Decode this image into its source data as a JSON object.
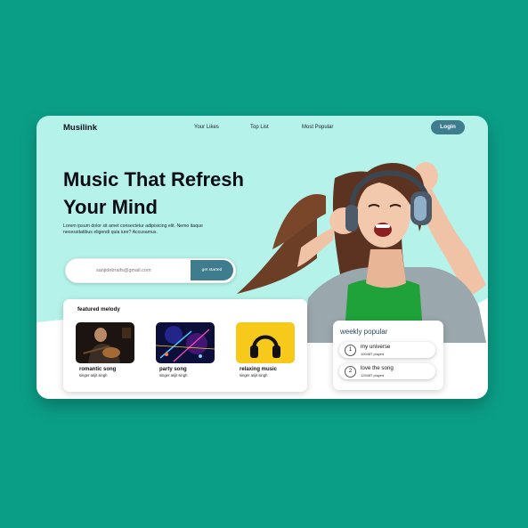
{
  "nav": {
    "logo": "Musilink",
    "links": [
      "Your Likes",
      "Top List",
      "Most Popular"
    ],
    "login": "Login"
  },
  "hero": {
    "title_line1": "Music That Refresh",
    "title_line2": "Your Mind",
    "description": "Lorem ipsum dolor sit amet consectetur adipisicing elit. Nemo itaque necessitatibus eligendi quia iure? Accusamus.",
    "email_value": "sanjidebraifs@gmail.com",
    "cta": "get started"
  },
  "featured": {
    "title": "featured melody",
    "songs": [
      {
        "title": "romantic song",
        "artist": "singer arijit singh",
        "icon": "guitarist-image"
      },
      {
        "title": "party song",
        "artist": "singer arijit singh",
        "icon": "concert-lights-image"
      },
      {
        "title": "relaxing music",
        "artist": "singer arijit singh",
        "icon": "headphones-icon"
      }
    ]
  },
  "weekly": {
    "title": "weekly popular",
    "items": [
      {
        "rank": "1",
        "title": "my universe",
        "played": "100487 played"
      },
      {
        "rank": "2",
        "title": "love the song",
        "played": "125487 played"
      }
    ]
  },
  "colors": {
    "background": "#0b9e87",
    "hero_bg": "#b5f3ea",
    "accent": "#3f7d8e",
    "relax_yellow": "#f7c91a"
  }
}
